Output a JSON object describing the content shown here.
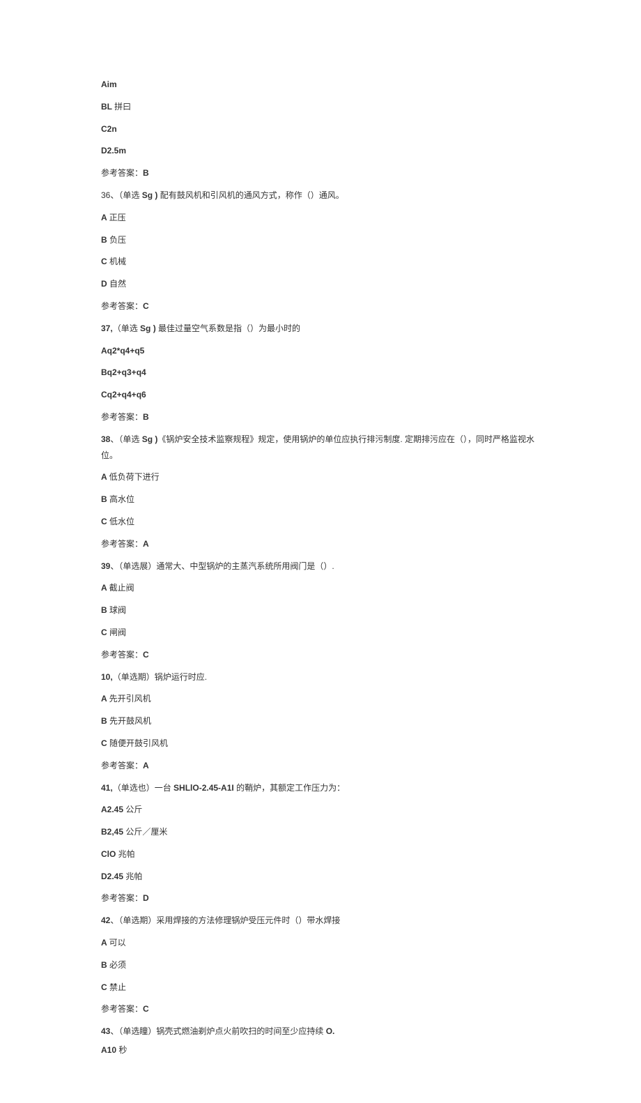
{
  "lines": [
    {
      "text": "Aim",
      "bold": true
    },
    {
      "text_parts": [
        {
          "t": "BL ",
          "b": true
        },
        {
          "t": "拼曰",
          "b": false
        }
      ]
    },
    {
      "text": "C2n",
      "bold": true
    },
    {
      "text": "D2.5m",
      "bold": true
    },
    {
      "text_parts": [
        {
          "t": "参考答案：",
          "b": false
        },
        {
          "t": "B",
          "b": true
        }
      ]
    },
    {
      "text_parts": [
        {
          "t": "36、（单选 ",
          "b": false
        },
        {
          "t": "Sg ) ",
          "b": true
        },
        {
          "t": "配有鼓风机和引风机的通风方式，称作（）通风。",
          "b": false
        }
      ]
    },
    {
      "text_parts": [
        {
          "t": "A ",
          "b": true
        },
        {
          "t": "正压",
          "b": false
        }
      ]
    },
    {
      "text_parts": [
        {
          "t": "B ",
          "b": true
        },
        {
          "t": "负压",
          "b": false
        }
      ]
    },
    {
      "text_parts": [
        {
          "t": "C ",
          "b": true
        },
        {
          "t": "机械",
          "b": false
        }
      ]
    },
    {
      "text_parts": [
        {
          "t": "D ",
          "b": true
        },
        {
          "t": "自然",
          "b": false
        }
      ]
    },
    {
      "text_parts": [
        {
          "t": "参考答案：",
          "b": false
        },
        {
          "t": "C",
          "b": true
        }
      ]
    },
    {
      "text_parts": [
        {
          "t": "37,",
          "b": true
        },
        {
          "t": "（单选 ",
          "b": false
        },
        {
          "t": "Sg ) ",
          "b": true
        },
        {
          "t": "最佳过量空气系数是指（）为最小时的",
          "b": false
        }
      ]
    },
    {
      "text": "Aq2*q4+q5",
      "bold": true
    },
    {
      "text": "Bq2+q3+q4",
      "bold": true
    },
    {
      "text": "Cq2+q4+q6",
      "bold": true
    },
    {
      "text_parts": [
        {
          "t": "参考答案：",
          "b": false
        },
        {
          "t": "B",
          "b": true
        }
      ]
    },
    {
      "text_parts": [
        {
          "t": "38",
          "b": true
        },
        {
          "t": "、（单选 ",
          "b": false
        },
        {
          "t": "Sg )",
          "b": true
        },
        {
          "t": "《锅炉安全技术监察规程》规定，使用锅炉的单位应执行排污制度. 定期排污应在（），同时严格监视水位。",
          "b": false
        }
      ]
    },
    {
      "text_parts": [
        {
          "t": "A ",
          "b": true
        },
        {
          "t": "低负荷下进行",
          "b": false
        }
      ]
    },
    {
      "text_parts": [
        {
          "t": "B ",
          "b": true
        },
        {
          "t": "高水位",
          "b": false
        }
      ]
    },
    {
      "text_parts": [
        {
          "t": "C ",
          "b": true
        },
        {
          "t": "低水位",
          "b": false
        }
      ]
    },
    {
      "text_parts": [
        {
          "t": "参考答案：",
          "b": false
        },
        {
          "t": "A",
          "b": true
        }
      ]
    },
    {
      "text_parts": [
        {
          "t": "39",
          "b": true
        },
        {
          "t": "、（单选展）通常大、中型锅炉的主蒸汽系统所用阀门是（）.",
          "b": false
        }
      ]
    },
    {
      "text_parts": [
        {
          "t": "A ",
          "b": true
        },
        {
          "t": "截止阀",
          "b": false
        }
      ]
    },
    {
      "text_parts": [
        {
          "t": "B ",
          "b": true
        },
        {
          "t": "球阀",
          "b": false
        }
      ]
    },
    {
      "text_parts": [
        {
          "t": "C ",
          "b": true
        },
        {
          "t": "闸阀",
          "b": false
        }
      ]
    },
    {
      "text_parts": [
        {
          "t": "参考答案：",
          "b": false
        },
        {
          "t": "C",
          "b": true
        }
      ]
    },
    {
      "text_parts": [
        {
          "t": "10,",
          "b": true
        },
        {
          "t": "（单选期）锅炉运行时应.",
          "b": false
        }
      ]
    },
    {
      "text_parts": [
        {
          "t": "A ",
          "b": true
        },
        {
          "t": "先开引风机",
          "b": false
        }
      ]
    },
    {
      "text_parts": [
        {
          "t": "B ",
          "b": true
        },
        {
          "t": "先开鼓风机",
          "b": false
        }
      ]
    },
    {
      "text_parts": [
        {
          "t": "C ",
          "b": true
        },
        {
          "t": "随便开鼓引风机",
          "b": false
        }
      ]
    },
    {
      "text_parts": [
        {
          "t": "参考答案：",
          "b": false
        },
        {
          "t": "A",
          "b": true
        }
      ]
    },
    {
      "text_parts": [
        {
          "t": "41,",
          "b": true
        },
        {
          "t": "（单选也）一台 ",
          "b": false
        },
        {
          "t": "SHLlO-2.45-A1I ",
          "b": true
        },
        {
          "t": "的鞘炉，其额定工作压力为：",
          "b": false
        }
      ]
    },
    {
      "text_parts": [
        {
          "t": "A2.45 ",
          "b": true
        },
        {
          "t": "公斤",
          "b": false
        }
      ]
    },
    {
      "text_parts": [
        {
          "t": "B2,45 ",
          "b": true
        },
        {
          "t": "公斤／厘米",
          "b": false
        }
      ]
    },
    {
      "text_parts": [
        {
          "t": "ClO ",
          "b": true
        },
        {
          "t": "兆帕",
          "b": false
        }
      ]
    },
    {
      "text_parts": [
        {
          "t": "D2.45 ",
          "b": true
        },
        {
          "t": "兆帕",
          "b": false
        }
      ]
    },
    {
      "text_parts": [
        {
          "t": "参考答案：",
          "b": false
        },
        {
          "t": "D",
          "b": true
        }
      ]
    },
    {
      "text_parts": [
        {
          "t": "42",
          "b": true
        },
        {
          "t": "、（单选期）采用焊接的方法修理锅炉受压元件时（）带水焊接",
          "b": false
        }
      ]
    },
    {
      "text_parts": [
        {
          "t": "A ",
          "b": true
        },
        {
          "t": "可以",
          "b": false
        }
      ]
    },
    {
      "text_parts": [
        {
          "t": "B ",
          "b": true
        },
        {
          "t": "必须",
          "b": false
        }
      ]
    },
    {
      "text_parts": [
        {
          "t": "C ",
          "b": true
        },
        {
          "t": "禁止",
          "b": false
        }
      ]
    },
    {
      "text_parts": [
        {
          "t": "参考答案：",
          "b": false
        },
        {
          "t": "C",
          "b": true
        }
      ]
    }
  ],
  "last_block": [
    {
      "text_parts": [
        {
          "t": "43",
          "b": true
        },
        {
          "t": "、（单选瞳）锅壳式燃油剃炉点火前吹扫的时间至少应持续 ",
          "b": false
        },
        {
          "t": "O.",
          "b": true
        }
      ]
    },
    {
      "text_parts": [
        {
          "t": "A10 ",
          "b": true
        },
        {
          "t": "秒",
          "b": false
        }
      ]
    }
  ]
}
